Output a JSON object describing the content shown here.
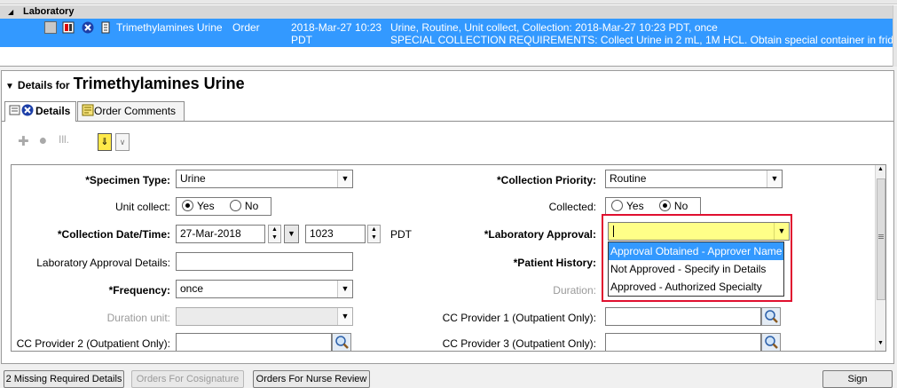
{
  "order_list": {
    "group_label": "Laboratory",
    "row": {
      "name": "Trimethylamines Urine",
      "type": "Order",
      "datetime": "2018-Mar-27 10:23",
      "tz": "PDT",
      "details_line1": "Urine, Routine, Unit collect, Collection: 2018-Mar-27 10:23 PDT, once",
      "details_line2": "SPECIAL COLLECTION REQUIREMENTS: Collect Urine in 2 mL, 1M HCL. Obtain special container in fridge ..."
    }
  },
  "details": {
    "title_prefix": "Details for",
    "title": "Trimethylamines Urine",
    "tabs": [
      {
        "label": "Details"
      },
      {
        "label": "Order Comments"
      }
    ]
  },
  "form": {
    "specimen_type": {
      "label": "*Specimen Type:",
      "value": "Urine"
    },
    "unit_collect": {
      "label": "Unit collect:",
      "yes": "Yes",
      "no": "No",
      "selected": "Yes"
    },
    "collection_datetime": {
      "label": "*Collection Date/Time:",
      "date": "27-Mar-2018",
      "time": "1023",
      "tz": "PDT"
    },
    "lab_approval_details": {
      "label": "Laboratory Approval Details:",
      "value": ""
    },
    "frequency": {
      "label": "*Frequency:",
      "value": "once"
    },
    "duration_unit": {
      "label": "Duration unit:",
      "value": ""
    },
    "cc_provider_2": {
      "label": "CC Provider 2 (Outpatient Only):",
      "value": ""
    },
    "collection_priority": {
      "label": "*Collection Priority:",
      "value": "Routine"
    },
    "collected": {
      "label": "Collected:",
      "yes": "Yes",
      "no": "No",
      "selected": "No"
    },
    "laboratory_approval": {
      "label": "*Laboratory Approval:",
      "value": "",
      "options": [
        "Approval Obtained - Approver Name",
        "Not Approved - Specify in Details",
        "Approved - Authorized Specialty"
      ],
      "highlighted_index": 0
    },
    "patient_history": {
      "label": "*Patient History:"
    },
    "duration": {
      "label": "Duration:"
    },
    "cc_provider_1": {
      "label": "CC Provider 1 (Outpatient Only):",
      "value": ""
    },
    "cc_provider_3": {
      "label": "CC Provider 3 (Outpatient Only):",
      "value": ""
    }
  },
  "bottom_bar": {
    "missing_details": "2 Missing Required Details",
    "orders_cosignature": "Orders For Cosignature",
    "orders_nurse_review": "Orders For Nurse Review",
    "sign": "Sign"
  },
  "colors": {
    "selection": "#3399ff",
    "approval_field": "#ffff88",
    "highlight_box": "#e0102f"
  }
}
